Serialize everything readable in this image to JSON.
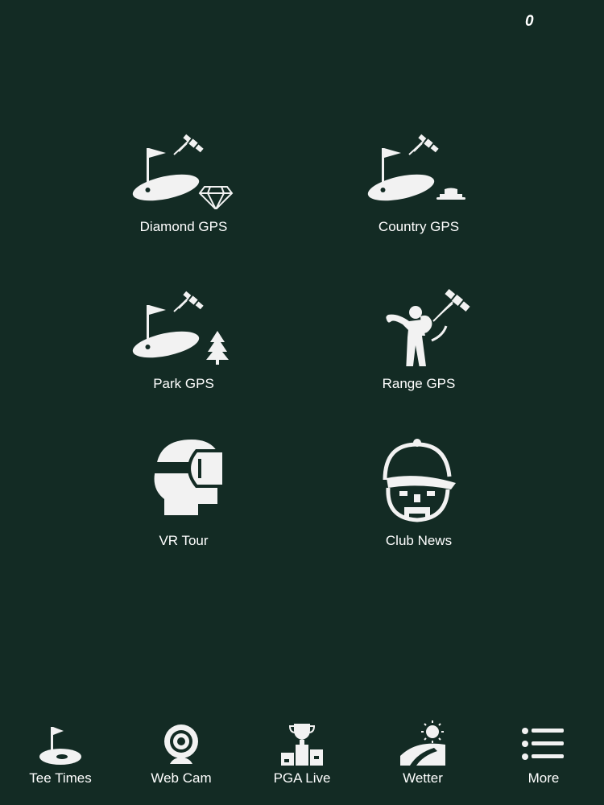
{
  "status": {
    "badge_count": "0"
  },
  "tiles": [
    {
      "label": "Diamond GPS",
      "icon": "flag-green-diamond-icon"
    },
    {
      "label": "Country GPS",
      "icon": "flag-green-hat-icon"
    },
    {
      "label": "Park GPS",
      "icon": "flag-green-tree-icon"
    },
    {
      "label": "Range GPS",
      "icon": "golfer-satellite-icon"
    },
    {
      "label": "VR Tour",
      "icon": "vr-headset-icon"
    },
    {
      "label": "Club News",
      "icon": "capped-man-icon"
    }
  ],
  "tabbar": [
    {
      "label": "Tee Times",
      "icon": "hole-flag-icon"
    },
    {
      "label": "Web Cam",
      "icon": "webcam-icon"
    },
    {
      "label": "PGA Live",
      "icon": "trophy-podium-icon"
    },
    {
      "label": "Wetter",
      "icon": "sun-landscape-icon"
    },
    {
      "label": "More",
      "icon": "list-icon"
    }
  ],
  "colors": {
    "background": "#132b24",
    "icon": "#f2f2f2"
  }
}
